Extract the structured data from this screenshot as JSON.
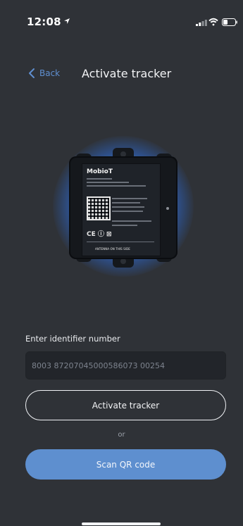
{
  "status_bar": {
    "time": "12:08"
  },
  "header": {
    "back_label": "Back",
    "title": "Activate tracker"
  },
  "device_label": {
    "brand": "MobioT",
    "bottom_text": "ANTENNA ON THIS SIDE"
  },
  "form": {
    "field_label": "Enter identifier number",
    "identifier_placeholder": "8003 87207045000586073 00254",
    "activate_button": "Activate tracker",
    "or_text": "or",
    "scan_button": "Scan QR code"
  },
  "colors": {
    "background": "#2f3237",
    "accent": "#5e8fcf",
    "glow": "#3a8cff"
  }
}
